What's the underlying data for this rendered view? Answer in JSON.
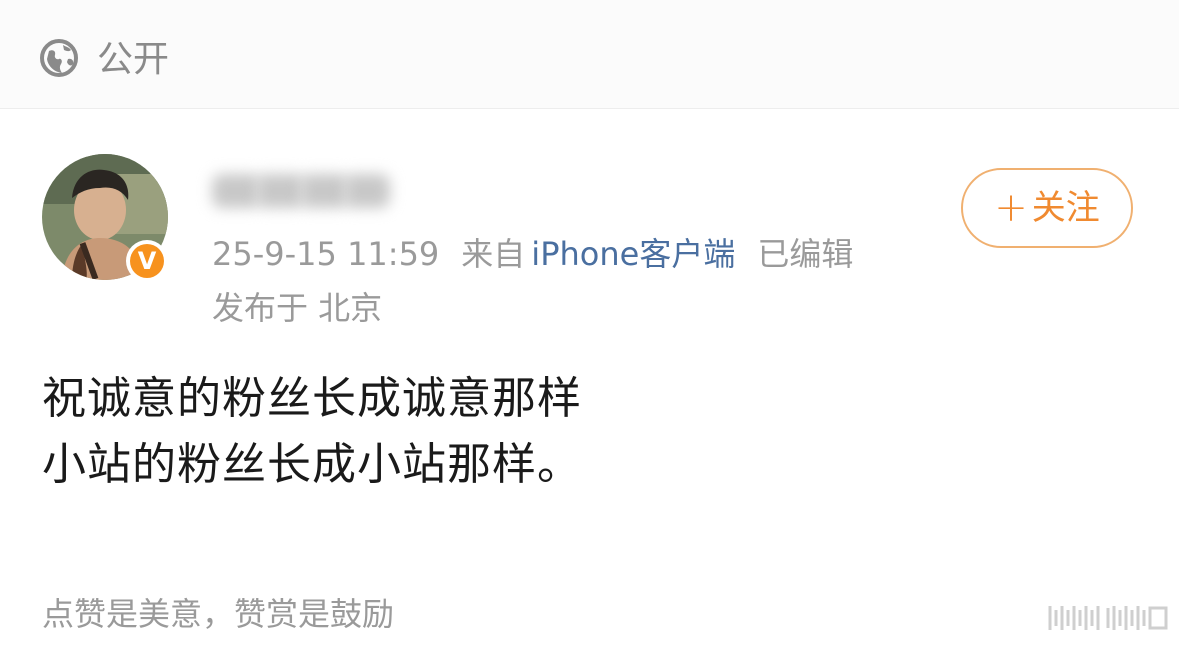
{
  "visibility": {
    "icon": "globe-icon",
    "label": "公开"
  },
  "post": {
    "author": {
      "avatar": "avatar",
      "verified_badge": "V",
      "verified_color": "#f7921e"
    },
    "follow_button": {
      "plus": "+",
      "label": "关注",
      "color": "#f08a30"
    },
    "meta": {
      "timestamp": "25-9-15 11:59",
      "source_prefix": "来自",
      "source_client": "iPhone客户端",
      "edited": "已编辑",
      "location": "发布于 北京"
    },
    "body_lines": [
      "祝诚意的粉丝长成诚意那样",
      "小站的粉丝长成小站那样。"
    ]
  },
  "footer": {
    "hint": "点赞是美意，赞赏是鼓励"
  }
}
